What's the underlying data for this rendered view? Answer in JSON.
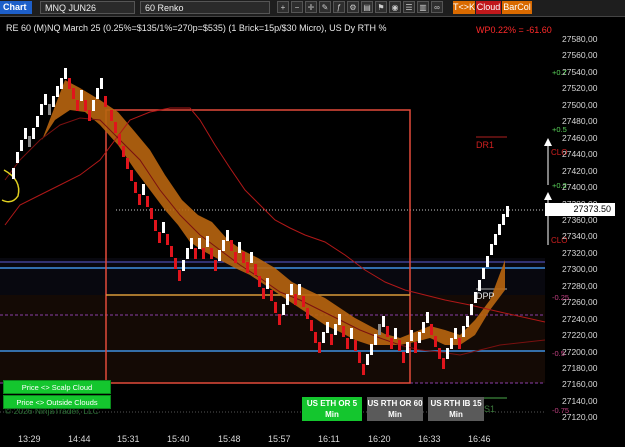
{
  "toolbar": {
    "chart_tab": "Chart",
    "instrument": "MNQ JUN26",
    "period": "60 Renko",
    "btn_tk": "T<>K",
    "btn_cloud": "Cloud",
    "btn_barcol": "BarCol"
  },
  "chart": {
    "title": "RE 60 (M)NQ March 25 (0.25%=$135/1%=270p=$535) (1 Brick=15p/$30 Micro), US Dy RTH %",
    "pnl_label": "WP0.22% = -61.60",
    "last_price": "27373.50",
    "price_axis": [
      "27580,00",
      "27560,00",
      "27540,00",
      "27520,00",
      "27500,00",
      "27480,00",
      "27460,00",
      "27440,00",
      "27420,00",
      "27400,00",
      "27380,00",
      "27360,00",
      "27340,00",
      "27320,00",
      "27300,00",
      "27280,00",
      "27260,00",
      "27240,00",
      "27220,00",
      "27200,00",
      "27180,00",
      "27160,00",
      "27140,00",
      "27120,00"
    ],
    "time_axis": [
      "13:29",
      "14:44",
      "15:31",
      "15:40",
      "15:48",
      "15:57",
      "16:11",
      "16:20",
      "16:33",
      "16:46"
    ],
    "pct_labels": [
      "+0.7",
      "+0.5",
      "+0.2",
      "-0.25",
      "-0.5",
      "-0.75"
    ],
    "level_labels": {
      "dr1": "DR1",
      "dpp": "DPP",
      "clo_top": "CLO",
      "clo_bottom": "CLO",
      "s1": "S1",
      "wp": "WP"
    },
    "price_scale": {
      "min": 27110,
      "max": 27590
    },
    "bricks": [
      {
        "x": 1,
        "c": "up"
      },
      {
        "x": 2,
        "c": "up"
      },
      {
        "x": 3,
        "c": "up"
      },
      {
        "x": 4,
        "c": "up"
      },
      {
        "x": 5,
        "c": "up"
      },
      {
        "x": 6,
        "c": "gray"
      },
      {
        "x": 7,
        "c": "up"
      },
      {
        "x": 8,
        "c": "up"
      },
      {
        "x": 9,
        "c": "up"
      },
      {
        "x": 10,
        "c": "gray"
      },
      {
        "x": 11,
        "c": "up"
      },
      {
        "x": 12,
        "c": "up"
      },
      {
        "x": 13,
        "c": "gray"
      },
      {
        "x": 14,
        "c": "up"
      },
      {
        "x": 15,
        "c": "dn"
      },
      {
        "x": 16,
        "c": "dn"
      },
      {
        "x": 17,
        "c": "up"
      },
      {
        "x": 18,
        "c": "dn"
      },
      {
        "x": 19,
        "c": "dn"
      },
      {
        "x": 20,
        "c": "dn"
      }
    ]
  },
  "buttons": {
    "scalp_cloud": "Price <> Scalp Cloud",
    "outside_clouds": "Price <> Outside Clouds",
    "us_eth_or": "US ETH OR 5 Min",
    "us_rth_or": "US RTH OR 60 Min",
    "us_rth_ib": "US RTH IB 15 Min"
  },
  "copyright": "© 2026 NinjaTrader, LLC",
  "colors": {
    "accent_orange": "#d96a00",
    "cloud_fill": "#b8650f",
    "up_brick": "#ffffff",
    "down_brick": "#e0141c",
    "blue_line": "#3f8fe0",
    "green_button": "#14c62e"
  }
}
